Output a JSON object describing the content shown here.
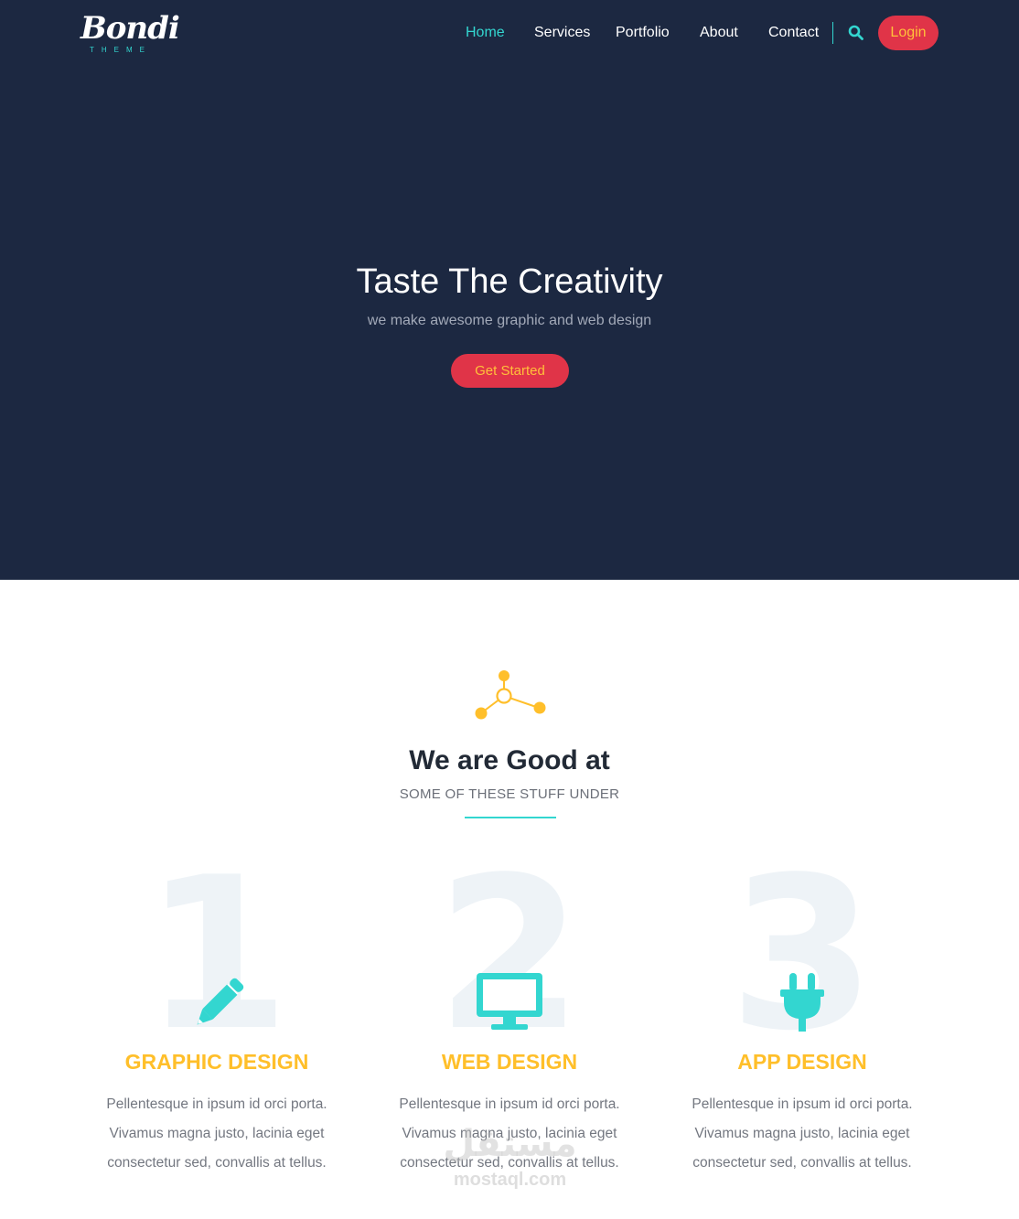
{
  "brand": {
    "logo_text": "Bondi",
    "logo_subtext": "THEME"
  },
  "nav": {
    "items": [
      {
        "label": "Home",
        "active": true
      },
      {
        "label": "Services",
        "active": false
      },
      {
        "label": "Portfolio",
        "active": false
      },
      {
        "label": "About",
        "active": false
      },
      {
        "label": "Contact",
        "active": false
      }
    ],
    "search_icon": "search-icon",
    "login_label": "Login"
  },
  "hero": {
    "title": "Taste The Creativity",
    "subtitle": "we make awesome graphic and web design",
    "cta_label": "Get Started"
  },
  "services_section": {
    "icon": "share-nodes-icon",
    "title": "We are Good at",
    "subtitle": "SOME OF THESE STUFF UNDER",
    "items": [
      {
        "number": "1",
        "icon": "pencil-icon",
        "title": "GRAPHIC DESIGN",
        "lines": [
          "Pellentesque in ipsum id orci porta.",
          "Vivamus magna justo, lacinia eget",
          "consectetur sed, convallis at tellus."
        ]
      },
      {
        "number": "2",
        "icon": "monitor-icon",
        "title": "WEB DESIGN",
        "lines": [
          "Pellentesque in ipsum id orci porta.",
          "Vivamus magna justo, lacinia eget",
          "consectetur sed, convallis at tellus."
        ]
      },
      {
        "number": "3",
        "icon": "plug-icon",
        "title": "APP DESIGN",
        "lines": [
          "Pellentesque in ipsum id orci porta.",
          "Vivamus magna justo, lacinia eget",
          "consectetur sed, convallis at tellus."
        ]
      }
    ]
  },
  "watermark": {
    "arabic": "مستقل",
    "latin": "mostaql.com"
  },
  "colors": {
    "hero_bg": "#1c2841",
    "accent_teal": "#33d6d0",
    "accent_red": "#e03448",
    "accent_yellow": "#ffbf2a"
  }
}
